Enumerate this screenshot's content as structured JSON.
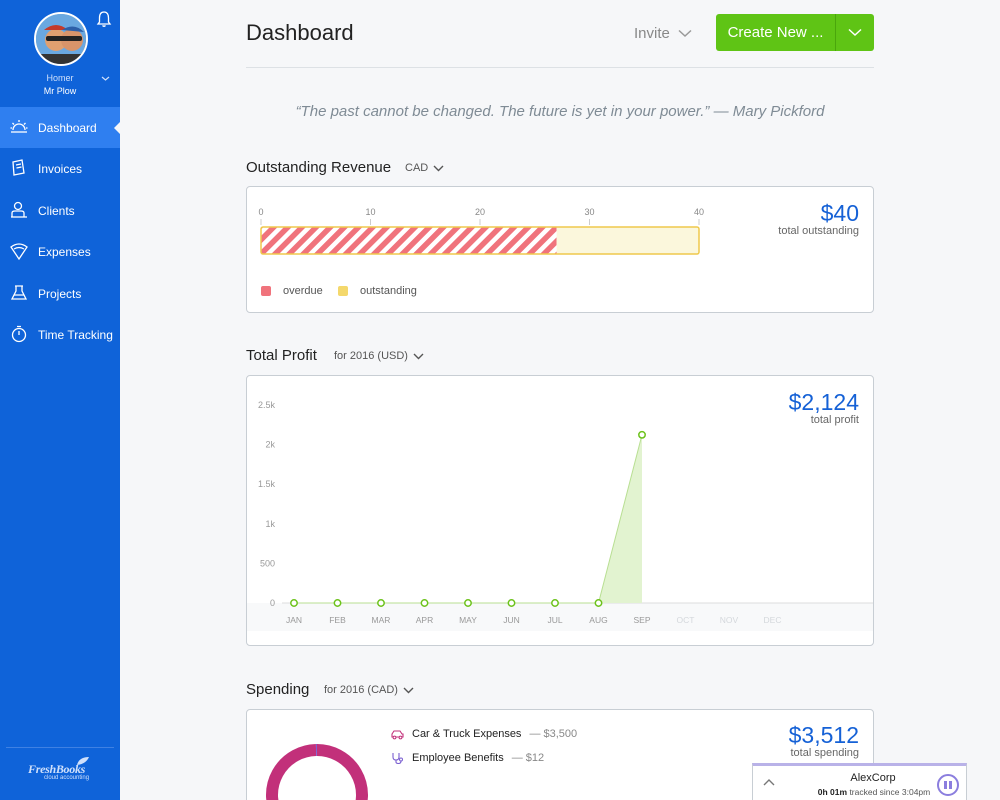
{
  "user": {
    "first_name": "Homer",
    "last_name": "Mr Plow"
  },
  "sidebar": {
    "items": [
      {
        "label": "Dashboard",
        "icon": "dashboard-icon",
        "active": true
      },
      {
        "label": "Invoices",
        "icon": "invoices-icon"
      },
      {
        "label": "Clients",
        "icon": "clients-icon"
      },
      {
        "label": "Expenses",
        "icon": "expenses-icon"
      },
      {
        "label": "Projects",
        "icon": "projects-icon"
      },
      {
        "label": "Time Tracking",
        "icon": "time-tracking-icon"
      }
    ],
    "logo_brand": "FreshBooks",
    "logo_tagline": "cloud accounting"
  },
  "header": {
    "title": "Dashboard",
    "invite_label": "Invite",
    "create_label": "Create New ..."
  },
  "quote": "“The past cannot be changed. The future is yet in your power.” — Mary Pickford",
  "outstanding": {
    "title": "Outstanding Revenue",
    "currency": "CAD",
    "total": "$40",
    "total_caption": "total outstanding",
    "legend": [
      "overdue",
      "outstanding"
    ]
  },
  "profit": {
    "title": "Total Profit",
    "period": "for 2016 (USD)",
    "total": "$2,124",
    "total_caption": "total profit"
  },
  "spending": {
    "title": "Spending",
    "period": "for 2016 (CAD)",
    "total": "$3,512",
    "total_caption": "total spending",
    "items": [
      {
        "label": "Car & Truck Expenses",
        "amount": "— $3,500"
      },
      {
        "label": "Employee Benefits",
        "amount": "— $12"
      }
    ]
  },
  "timer": {
    "client": "AlexCorp",
    "elapsed": "0h 01m",
    "since": "tracked since 3:04pm"
  },
  "colors": {
    "sidebar": "#0f63d9",
    "accent_blue": "#1561d6",
    "create_green": "#5fc415",
    "overdue": "#f0737c",
    "outstanding": "#f4d86c",
    "profit_line": "#6cc21b",
    "spending_ring": "#c2307a"
  },
  "chart_data": [
    {
      "type": "bar",
      "orientation": "horizontal",
      "stacked": true,
      "xlim": [
        0,
        40
      ],
      "xticks": [
        0,
        10,
        20,
        30,
        40
      ],
      "series": [
        {
          "name": "overdue",
          "values": [
            27
          ]
        },
        {
          "name": "outstanding",
          "values": [
            13
          ]
        }
      ]
    },
    {
      "type": "area",
      "categories": [
        "JAN",
        "FEB",
        "MAR",
        "APR",
        "MAY",
        "JUN",
        "JUL",
        "AUG",
        "SEP",
        "OCT",
        "NOV",
        "DEC"
      ],
      "values": [
        0,
        0,
        0,
        0,
        0,
        0,
        0,
        0,
        2124,
        null,
        null,
        null
      ],
      "ylim": [
        0,
        2500
      ],
      "yticks": [
        0,
        500,
        1000,
        1500,
        2000,
        2500
      ],
      "ytick_labels": [
        "0",
        "500",
        "1k",
        "1.5k",
        "2k",
        "2.5k"
      ],
      "grid": false
    },
    {
      "type": "pie",
      "donut": true,
      "categories": [
        "Car & Truck Expenses",
        "Employee Benefits"
      ],
      "values": [
        3500,
        12
      ]
    }
  ]
}
